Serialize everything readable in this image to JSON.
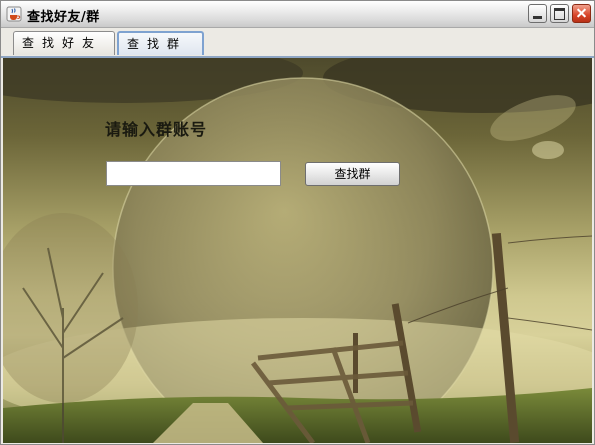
{
  "window": {
    "title": "查找好友/群"
  },
  "tabs": [
    {
      "label": "查找好友",
      "selected": false
    },
    {
      "label": "查找群",
      "selected": true
    }
  ],
  "form": {
    "prompt": "请输入群账号",
    "input_value": "",
    "search_button": "查找群"
  },
  "colors": {
    "tab_selected_border": "#7ea2d0",
    "close_button": "#d8452a",
    "scene_tone": "#cfc88f"
  }
}
